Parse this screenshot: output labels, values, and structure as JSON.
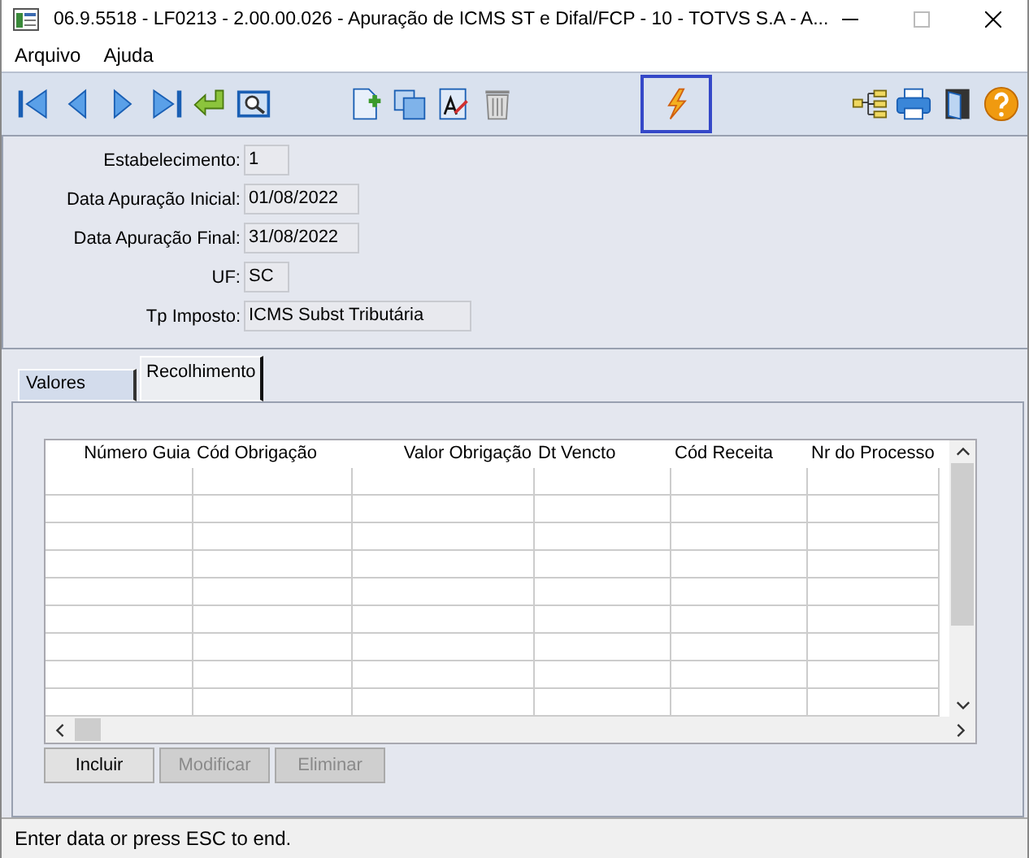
{
  "window": {
    "title": "06.9.5518 - LF0213 - 2.00.00.026 - Apuração de ICMS ST e Difal/FCP - 10 - TOTVS S.A - A..."
  },
  "menu": [
    {
      "label": "Arquivo"
    },
    {
      "label": "Ajuda"
    }
  ],
  "toolbar": {
    "groups": [
      [
        {
          "kind": "first",
          "selected": false
        },
        {
          "kind": "prev",
          "selected": false
        },
        {
          "kind": "next",
          "selected": false
        },
        {
          "kind": "last",
          "selected": false
        },
        {
          "kind": "enter",
          "selected": false
        },
        {
          "kind": "zoom",
          "selected": false
        }
      ],
      [
        {
          "kind": "new",
          "selected": false
        },
        {
          "kind": "copy",
          "selected": false
        },
        {
          "kind": "edit",
          "selected": false
        },
        {
          "kind": "trash",
          "selected": false
        }
      ],
      [
        {
          "kind": "bolt",
          "selected": true
        }
      ],
      [
        {
          "kind": "tree",
          "selected": false
        },
        {
          "kind": "print",
          "selected": false
        },
        {
          "kind": "exit",
          "selected": false
        },
        {
          "kind": "help",
          "selected": false
        }
      ]
    ]
  },
  "form": [
    {
      "label": "Estabelecimento:",
      "value": "1"
    },
    {
      "label": "Data Apuração Inicial:",
      "value": "01/08/2022"
    },
    {
      "label": "Data Apuração Final:",
      "value": "31/08/2022"
    },
    {
      "label": "UF:",
      "value": "SC"
    },
    {
      "label": "Tp Imposto:",
      "value": "ICMS Subst Tributária"
    }
  ],
  "tabs": [
    {
      "label": "Valores",
      "selected": false
    },
    {
      "label": "Recolhimento",
      "selected": true
    }
  ],
  "table": {
    "columns": [
      {
        "label": "Número Guia"
      },
      {
        "label": "Cód Obrigação"
      },
      {
        "label": "Valor Obrigação"
      },
      {
        "label": "Dt Vencto"
      },
      {
        "label": "Cód Receita"
      },
      {
        "label": "Nr do Processo"
      }
    ]
  },
  "buttons": [
    {
      "label": "Incluir",
      "disabled": false
    },
    {
      "label": "Modificar",
      "disabled": true
    },
    {
      "label": "Eliminar",
      "disabled": true
    }
  ],
  "status_bar": "Enter data or press ESC to end."
}
